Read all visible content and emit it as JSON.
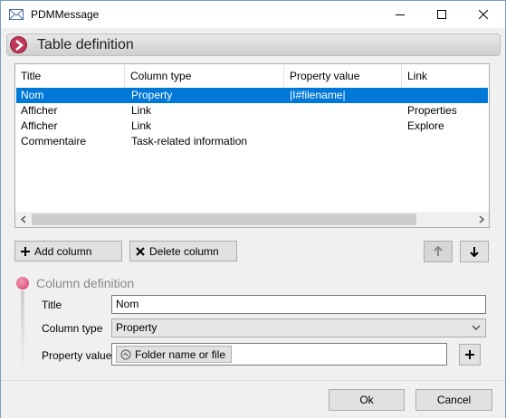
{
  "window": {
    "title": "PDMMessage"
  },
  "section": {
    "title": "Table definition"
  },
  "table": {
    "columns": [
      "Title",
      "Column type",
      "Property value",
      "Link"
    ],
    "rows": [
      {
        "title": "Nom",
        "type": "Property",
        "value": "|I#filename|",
        "link": "",
        "selected": true
      },
      {
        "title": "Afficher",
        "type": "Link",
        "value": "",
        "link": "Properties"
      },
      {
        "title": "Afficher",
        "type": "Link",
        "value": "",
        "link": "Explore"
      },
      {
        "title": "Commentaire",
        "type": "Task-related information",
        "value": "",
        "link": ""
      }
    ]
  },
  "buttons": {
    "add_column": "Add column",
    "delete_column": "Delete column",
    "ok": "Ok",
    "cancel": "Cancel"
  },
  "column_definition": {
    "heading": "Column definition",
    "title_label": "Title",
    "title_value": "Nom",
    "type_label": "Column type",
    "type_value": "Property",
    "prop_label": "Property value",
    "prop_chip": "Folder name or file"
  },
  "colors": {
    "selection": "#0078d7",
    "accent": "#c0395a"
  }
}
